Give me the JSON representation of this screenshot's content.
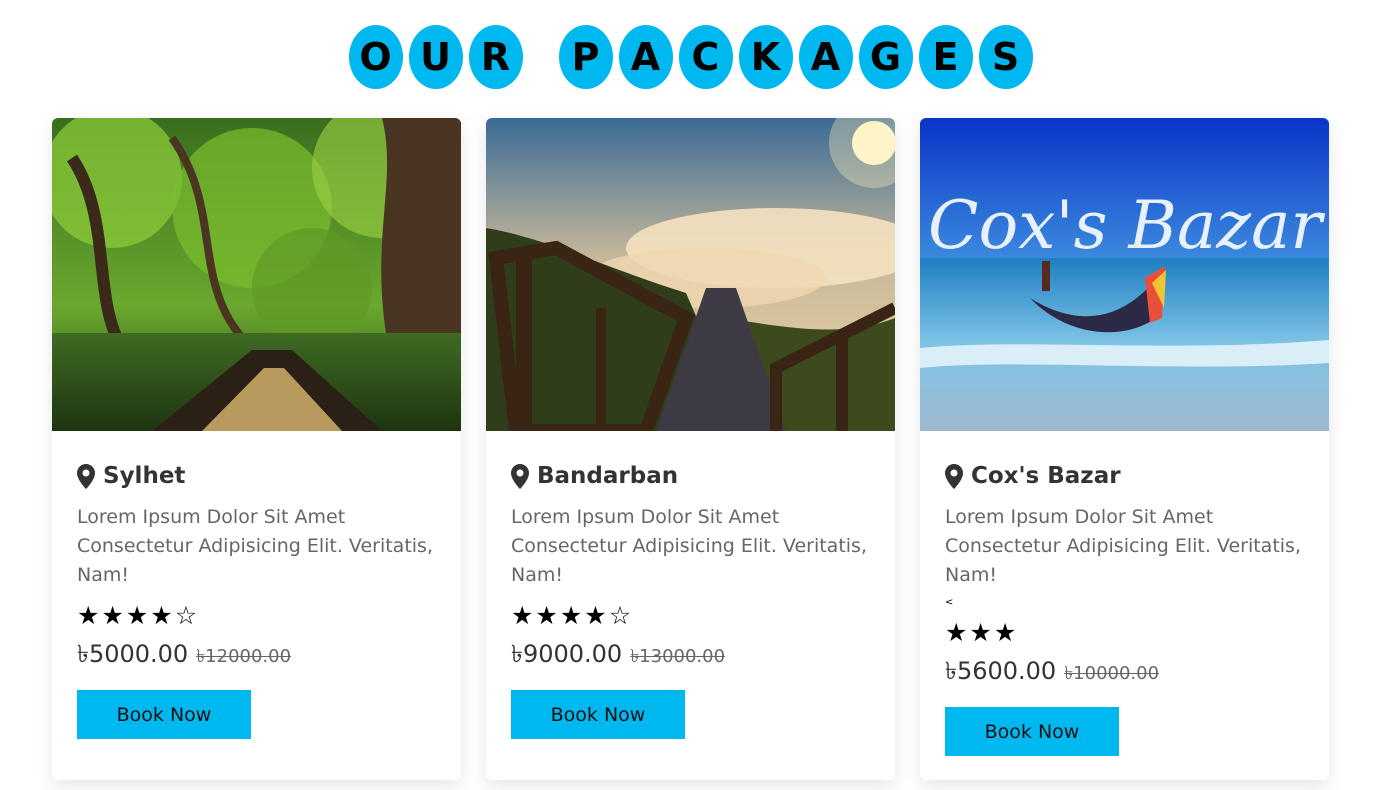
{
  "heading": {
    "words": [
      [
        "O",
        "U",
        "R"
      ],
      [
        "P",
        "A",
        "C",
        "K",
        "A",
        "G",
        "E",
        "S"
      ]
    ]
  },
  "colors": {
    "accent": "#00b8f0"
  },
  "packages": [
    {
      "location": "Sylhet",
      "description": "Lorem Ipsum Dolor Sit Amet Consectetur Adipisicing Elit. Veritatis, Nam!",
      "rating_filled": 4,
      "rating_empty": 1,
      "price": "৳5000.00",
      "old_price": "৳12000.00",
      "button": "Book Now",
      "image_icon": "mangrove-boat-image"
    },
    {
      "location": "Bandarban",
      "description": "Lorem Ipsum Dolor Sit Amet Consectetur Adipisicing Elit. Veritatis, Nam!",
      "rating_filled": 4,
      "rating_empty": 1,
      "price": "৳9000.00",
      "old_price": "৳13000.00",
      "button": "Book Now",
      "image_icon": "hill-stairs-image"
    },
    {
      "location": "Cox's Bazar",
      "description": "Lorem Ipsum Dolor Sit Amet Consectetur Adipisicing Elit. Veritatis, Nam!",
      "stray_text": "<",
      "rating_filled": 3,
      "rating_empty": 0,
      "price": "৳5600.00",
      "old_price": "৳10000.00",
      "button": "Book Now",
      "image_text": "Cox's Bazar",
      "image_icon": "beach-boat-image"
    }
  ]
}
